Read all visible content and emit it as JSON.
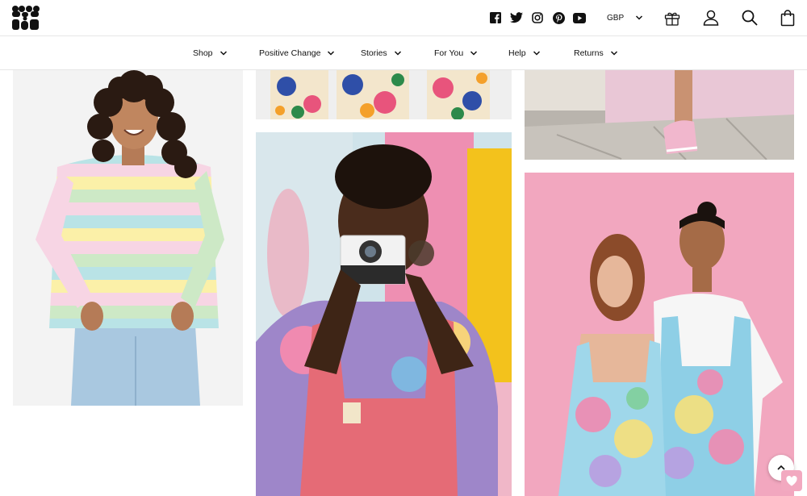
{
  "header": {
    "logo_alt": "Lucy & Yak",
    "currency": "GBP",
    "social": [
      "facebook-icon",
      "twitter-icon",
      "instagram-icon",
      "pinterest-icon",
      "youtube-icon"
    ]
  },
  "nav": {
    "items": [
      {
        "label": "Shop"
      },
      {
        "label": "Positive Change"
      },
      {
        "label": "Stories"
      },
      {
        "label": "For You"
      },
      {
        "label": "Help"
      },
      {
        "label": "Returns"
      }
    ]
  },
  "gallery": {
    "tiles": [
      {
        "desc": "woman-striped-pastel-top"
      },
      {
        "desc": "floral-trousers-crop"
      },
      {
        "desc": "man-with-polaroid-camera"
      },
      {
        "desc": "pink-sneakers-crop"
      },
      {
        "desc": "couple-tie-dye-dungarees"
      }
    ]
  },
  "colors": {
    "accent_pink": "#f2a9c0",
    "border": "#e6e6e6"
  }
}
